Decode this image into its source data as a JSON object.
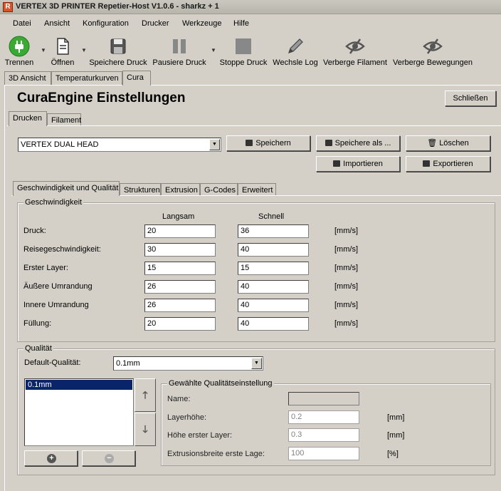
{
  "window": {
    "title": "VERTEX 3D PRINTER Repetier-Host V1.0.6 - sharkz + 1"
  },
  "menu": [
    "Datei",
    "Ansicht",
    "Konfiguration",
    "Drucker",
    "Werkzeuge",
    "Hilfe"
  ],
  "toolbar": {
    "disconnect": "Trennen",
    "open": "Öffnen",
    "save_print": "Speichere Druck",
    "pause_print": "Pausiere Druck",
    "stop_print": "Stoppe Druck",
    "toggle_log": "Wechsle Log",
    "hide_filament": "Verberge Filament",
    "hide_moves": "Verberge Bewegungen",
    "colors": {
      "connect_green": "#3aaa35"
    }
  },
  "main_tabs": [
    "3D Ansicht",
    "Temperaturkurven",
    "Cura"
  ],
  "cura": {
    "title": "CuraEngine Einstellungen",
    "close": "Schließen",
    "tabs": [
      "Drucken",
      "Filament"
    ],
    "profile": "VERTEX DUAL HEAD",
    "buttons": {
      "save": "Speichern",
      "save_as": "Speichere als ...",
      "delete": "Löschen",
      "import": "Importieren",
      "export": "Exportieren"
    },
    "settings_tabs": [
      "Geschwindigkeit und Qualität",
      "Strukturen",
      "Extrusion",
      "G-Codes",
      "Erweitert"
    ],
    "speed": {
      "group": "Geschwindigkeit",
      "col_slow": "Langsam",
      "col_fast": "Schnell",
      "rows": [
        {
          "label": "Druck:",
          "slow": "20",
          "fast": "36",
          "unit": "[mm/s]"
        },
        {
          "label": "Reisegeschwindigkeit:",
          "slow": "30",
          "fast": "40",
          "unit": "[mm/s]"
        },
        {
          "label": "Erster Layer:",
          "slow": "15",
          "fast": "15",
          "unit": "[mm/s]"
        },
        {
          "label": "Äußere Umrandung",
          "slow": "26",
          "fast": "40",
          "unit": "[mm/s]"
        },
        {
          "label": "Innere Umrandung",
          "slow": "26",
          "fast": "40",
          "unit": "[mm/s]"
        },
        {
          "label": "Füllung:",
          "slow": "20",
          "fast": "40",
          "unit": "[mm/s]"
        }
      ]
    },
    "quality": {
      "group": "Qualität",
      "default_label": "Default-Qualität:",
      "default_value": "0.1mm",
      "list": [
        "0.1mm"
      ],
      "selected_group": "Gewählte Qualitätseinstellung",
      "name_label": "Name:",
      "name_value": "",
      "rows": [
        {
          "label": "Layerhöhe:",
          "value": "0.2",
          "unit": "[mm]"
        },
        {
          "label": "Höhe erster Layer:",
          "value": "0.3",
          "unit": "[mm]"
        },
        {
          "label": "Extrusionsbreite erste Lage:",
          "value": "100",
          "unit": "[%]"
        }
      ]
    }
  }
}
